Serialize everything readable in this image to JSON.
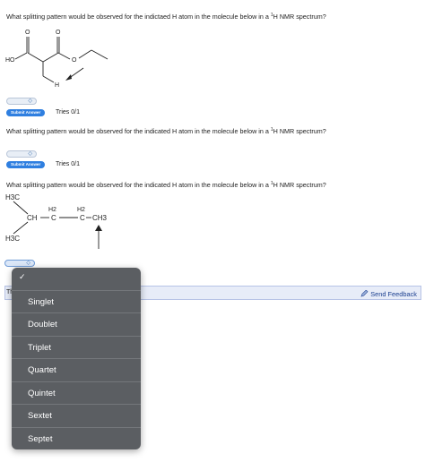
{
  "questions": [
    {
      "text_before": "What splitting pattern would be observed for the indictaed H atom in the molecule below in a ",
      "sup": "1",
      "text_after": "H NMR spectrum?",
      "submit_label": "Submit Answer",
      "tries": "Tries 0/1",
      "molecule_labels": {
        "o1": "O",
        "o2": "O",
        "o3": "O",
        "ho": "HO",
        "h": "H"
      }
    },
    {
      "text_before": "What splitting pattern would be observed for the indicated H atom in the molecule below in a ",
      "sup": "1",
      "text_after": "H NMR spectrum?",
      "submit_label": "Submit Answer",
      "tries": "Tries 0/1"
    },
    {
      "text_before": "What splitting pattern would be observed for the indicated H atom in the molecule below in a ",
      "sup": "1",
      "text_after": "H NMR spectrum?",
      "molecule_labels": {
        "h3c_top": "H3C",
        "h3c_bottom": "H3C",
        "ch": "CH",
        "h2_a": "H2",
        "c_a": "C",
        "h2_b": "H2",
        "c_b": "C",
        "ch3": "CH3"
      }
    }
  ],
  "select_chevron": "◇",
  "feedback_bar": {
    "left_text": "Th",
    "send_feedback": "Send Feedback"
  },
  "dropdown": {
    "checkmark": "✓",
    "options": [
      "Singlet",
      "Doublet",
      "Triplet",
      "Quartet",
      "Quintet",
      "Sextet",
      "Septet"
    ]
  },
  "colors": {
    "accent": "#2f7fe0",
    "dropdown_bg": "#5b5e62",
    "feedback_bar": "#e7ecf8"
  }
}
